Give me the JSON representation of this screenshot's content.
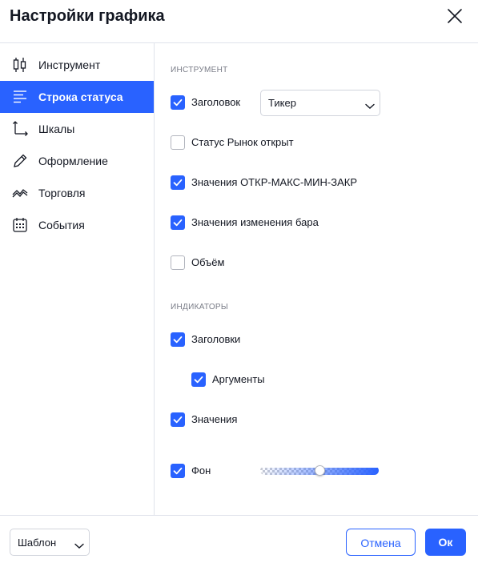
{
  "dialog": {
    "title": "Настройки графика"
  },
  "sidebar": {
    "items": [
      {
        "label": "Инструмент",
        "icon": "candles-icon",
        "active": false
      },
      {
        "label": "Строка статуса",
        "icon": "status-line-icon",
        "active": true
      },
      {
        "label": "Шкалы",
        "icon": "scales-icon",
        "active": false
      },
      {
        "label": "Оформление",
        "icon": "pencil-icon",
        "active": false
      },
      {
        "label": "Торговля",
        "icon": "trading-icon",
        "active": false
      },
      {
        "label": "События",
        "icon": "calendar-icon",
        "active": false
      }
    ]
  },
  "instrument_section": {
    "title": "ИНСТРУМЕНТ",
    "title_checkbox": {
      "label": "Заголовок",
      "checked": true
    },
    "title_select": {
      "value": "Тикер"
    },
    "market_status": {
      "label": "Статус Рынок открыт",
      "checked": false
    },
    "ohlc_values": {
      "label": "Значения ОТКР-МАКС-МИН-ЗАКР",
      "checked": true
    },
    "bar_change_values": {
      "label": "Значения изменения бара",
      "checked": true
    },
    "volume": {
      "label": "Объём",
      "checked": false
    }
  },
  "indicators_section": {
    "title": "ИНДИКАТОРЫ",
    "titles": {
      "label": "Заголовки",
      "checked": true
    },
    "arguments": {
      "label": "Аргументы",
      "checked": true
    },
    "values": {
      "label": "Значения",
      "checked": true
    },
    "background": {
      "label": "Фон",
      "checked": true,
      "opacity_fraction": 0.5
    }
  },
  "footer": {
    "template_select": {
      "value": "Шаблон"
    },
    "cancel_label": "Отмена",
    "ok_label": "Ок"
  },
  "colors": {
    "accent": "#2962ff",
    "text": "#131722",
    "muted": "#787b86",
    "border": "#e0e3eb"
  }
}
